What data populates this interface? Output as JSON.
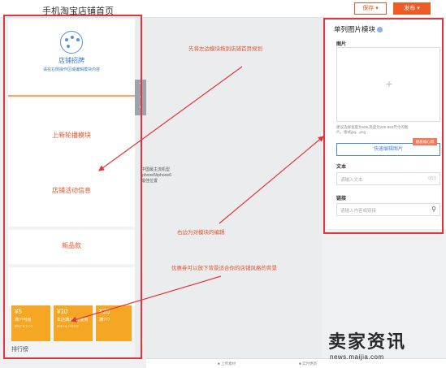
{
  "header": {
    "title": "手机淘宝店铺首页",
    "save_label": "保存 ▾",
    "publish_label": "发布 ▾"
  },
  "canvas": {
    "shop_sign_title": "店铺招牌",
    "shop_sign_sub": "请在右侧操作区域编辑模块内容",
    "carousel_label": "上新轮播模块",
    "promo_label": "店铺活动信息",
    "new_arrival_label": "新品款",
    "coupons": [
      {
        "amount": "¥5",
        "cond": "满??可用",
        "date": "2017.5 ????"
      },
      {
        "amount": "¥10",
        "cond": "本店满100元使用",
        "date": "2017.5.??????"
      },
      {
        "amount": "¥20",
        "cond": "满???",
        "date": ""
      }
    ],
    "rank_label": "排行榜",
    "side_note": [
      "中国最主流机型",
      "iphone5/iphone6",
      "最佳位置"
    ]
  },
  "annotations": {
    "tip_top": "先将左边模块拖到店铺首页规划",
    "tip_middle": "右边为对模块的编辑",
    "tip_bottom": "优惠券可以放下背景适合你的店铺风格的背景"
  },
  "panel": {
    "title": "单列图片模块",
    "image_label": "图片",
    "image_hint": "建议选择宽度为608,高度为200-960尺寸的图片，格式jpg、png",
    "badge": "模板缩心得",
    "edit_image_button": "快速编辑图片",
    "text_label": "文本",
    "text_placeholder": "请输入文本",
    "text_count": "0/15",
    "link_label": "链接",
    "link_placeholder": "请输入内容或链接"
  },
  "statusbar": {
    "item1": "■ 上传素材",
    "item2": "■ 实时更新"
  },
  "watermark": {
    "brand": "卖家资讯",
    "url": "news.maijia.com"
  },
  "colors": {
    "accent": "#e4542d",
    "highlight": "#e6333b",
    "primary_blue": "#3a78c9",
    "coupon": "#f5a623"
  }
}
